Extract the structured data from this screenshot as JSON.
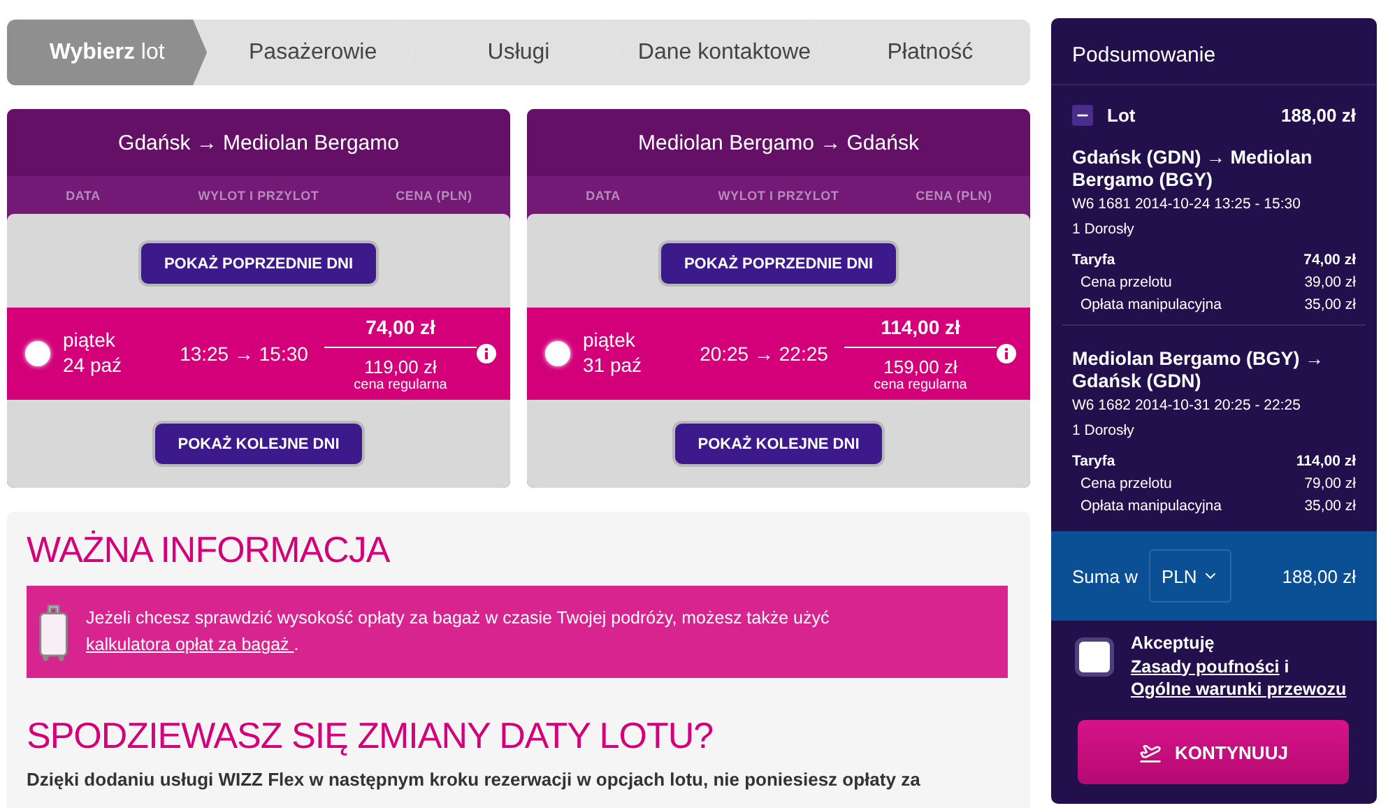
{
  "steps": [
    {
      "label": "**Wybierz** lot",
      "selected": true
    },
    {
      "label": "Pasażerowie",
      "selected": false
    },
    {
      "label": "Usługi",
      "selected": false
    },
    {
      "label": "Dane kontaktowe",
      "selected": false
    },
    {
      "label": "Płatność",
      "selected": false
    }
  ],
  "flights": [
    {
      "route": "Gdańsk → Mediolan Bergamo",
      "columns": [
        "DATA",
        "WYLOT I PRZYLOT",
        "CENA (PLN)"
      ],
      "prev_button": "POKAŻ POPRZEDNIE DNI",
      "next_button": "POKAŻ KOLEJNE DNI",
      "option": {
        "selected": false,
        "day": "piątek",
        "date": "24 paź",
        "times": "13:25 → 15:30",
        "price": "74,00 zł",
        "regular_price": "119,00 zł",
        "regular_label": "cena regularna"
      }
    },
    {
      "route": "Mediolan Bergamo → Gdańsk",
      "columns": [
        "DATA",
        "WYLOT I PRZYLOT",
        "CENA (PLN)"
      ],
      "prev_button": "POKAŻ POPRZEDNIE DNI",
      "next_button": "POKAŻ KOLEJNE DNI",
      "option": {
        "selected": false,
        "day": "piątek",
        "date": "31 paź",
        "times": "20:25 → 22:25",
        "price": "114,00 zł",
        "regular_price": "159,00 zł",
        "regular_label": "cena regularna"
      }
    }
  ],
  "info": {
    "title": "WAŻNA INFORMACJA",
    "notice": "Jeżeli chcesz sprawdzić wysokość opłaty za bagaż w czasie Twojej podróży, możesz także użyć ",
    "notice_link": "kalkulatora opłat za bagaż ",
    "notice_end": ".",
    "flex_title": "SPODZIEWASZ SIĘ ZMIANY DATY LOTU?",
    "flex_text": "Dzięki dodaniu usługi WIZZ Flex w następnym kroku rezerwacji w opcjach lotu, nie poniesiesz opłaty za"
  },
  "summary": {
    "title": "Podsumowanie",
    "lot": {
      "label": "Lot",
      "total": "188,00 zł",
      "expanded": true
    },
    "legs": [
      {
        "route": "Gdańsk (GDN) → Mediolan Bergamo (BGY)",
        "flight": "W6 1681  2014-10-24 13:25 - 15:30",
        "passengers": "1 Dorosły",
        "fare_label": "Taryfa",
        "fare": "74,00 zł",
        "items": [
          {
            "label": "Cena przelotu",
            "value": "39,00 zł"
          },
          {
            "label": "Opłata manipulacyjna",
            "value": "35,00 zł"
          }
        ]
      },
      {
        "route": "Mediolan Bergamo (BGY) → Gdańsk (GDN)",
        "flight": "W6 1682  2014-10-31 20:25 - 22:25",
        "passengers": "1 Dorosły",
        "fare_label": "Taryfa",
        "fare": "114,00 zł",
        "items": [
          {
            "label": "Cena przelotu",
            "value": "79,00 zł"
          },
          {
            "label": "Opłata manipulacyjna",
            "value": "35,00 zł"
          }
        ]
      }
    ],
    "total": {
      "label": "Suma w",
      "currency": "PLN",
      "value": "188,00 zł"
    },
    "terms": {
      "checked": false,
      "prefix": "Akceptuję ",
      "link1": "Zasady poufności",
      "middle": " i ",
      "link2": "Ogólne warunki przewozu"
    },
    "continue_button": "KONTYNUUJ"
  }
}
